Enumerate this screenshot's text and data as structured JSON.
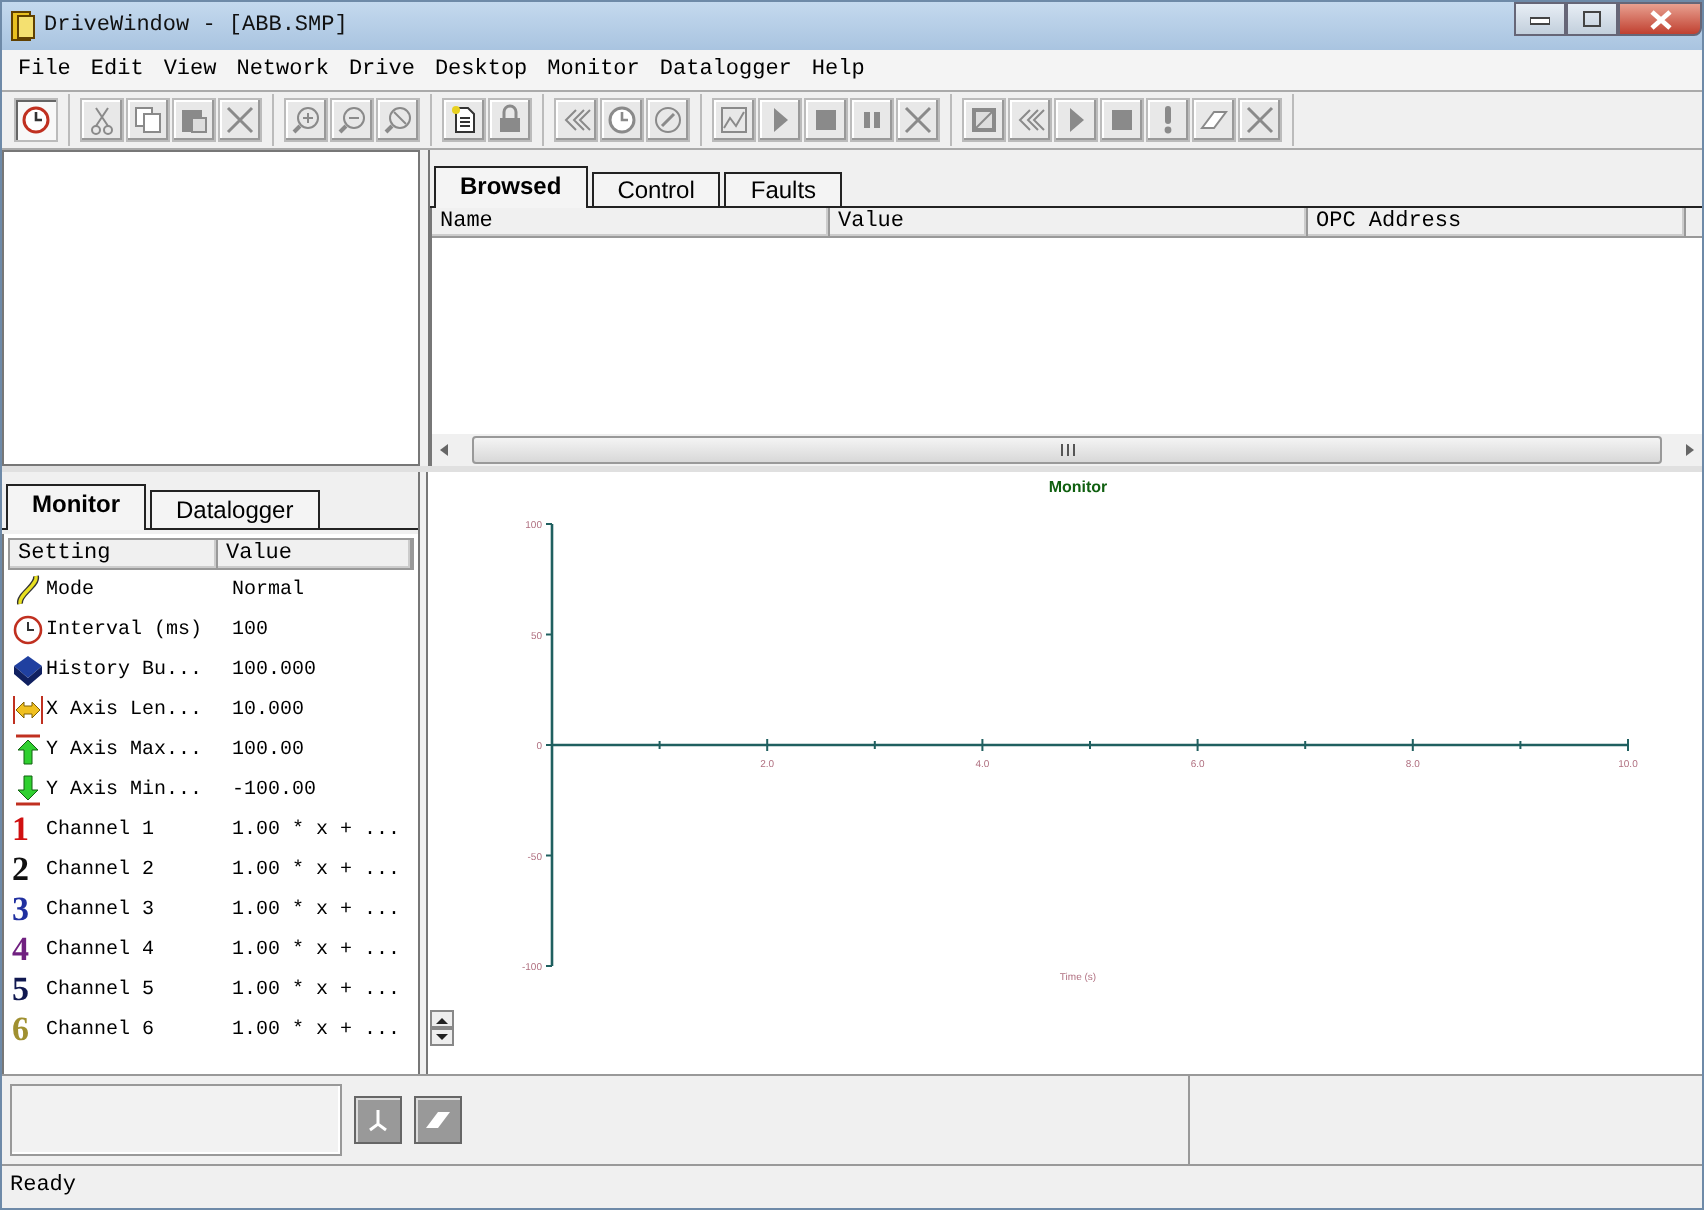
{
  "window": {
    "title": "DriveWindow - [ABB.SMP]"
  },
  "menu": [
    {
      "label": "File"
    },
    {
      "label": "Edit"
    },
    {
      "label": "View"
    },
    {
      "label": "Network"
    },
    {
      "label": "Drive"
    },
    {
      "label": "Desktop"
    },
    {
      "label": "Monitor"
    },
    {
      "label": "Datalogger"
    },
    {
      "label": "Help"
    }
  ],
  "toolbar": [
    [
      {
        "kind": "clock",
        "disabled": false,
        "pressed": true
      }
    ],
    [
      {
        "kind": "cut",
        "disabled": true,
        "pressed": false
      },
      {
        "kind": "copy",
        "disabled": true,
        "pressed": false
      },
      {
        "kind": "paste",
        "disabled": true,
        "pressed": false
      },
      {
        "kind": "delete",
        "disabled": true,
        "pressed": false
      }
    ],
    [
      {
        "kind": "zoom-in",
        "disabled": true,
        "pressed": false
      },
      {
        "kind": "zoom-out",
        "disabled": true,
        "pressed": false
      },
      {
        "kind": "zoom-reset",
        "disabled": true,
        "pressed": false
      }
    ],
    [
      {
        "kind": "new",
        "disabled": false,
        "pressed": false
      },
      {
        "kind": "lock",
        "disabled": true,
        "pressed": false
      }
    ],
    [
      {
        "kind": "rewind",
        "disabled": true,
        "pressed": false
      },
      {
        "kind": "clock",
        "disabled": true,
        "pressed": false
      },
      {
        "kind": "pen",
        "disabled": true,
        "pressed": false
      }
    ],
    [
      {
        "kind": "chart",
        "disabled": true,
        "pressed": false
      },
      {
        "kind": "play",
        "disabled": true,
        "pressed": false
      },
      {
        "kind": "stop",
        "disabled": true,
        "pressed": false
      },
      {
        "kind": "pause",
        "disabled": true,
        "pressed": false
      },
      {
        "kind": "delete",
        "disabled": true,
        "pressed": false
      }
    ],
    [
      {
        "kind": "frame",
        "disabled": true,
        "pressed": false
      },
      {
        "kind": "rewind",
        "disabled": true,
        "pressed": false
      },
      {
        "kind": "play",
        "disabled": true,
        "pressed": false
      },
      {
        "kind": "stop",
        "disabled": true,
        "pressed": false
      },
      {
        "kind": "exclaim",
        "disabled": true,
        "pressed": false
      },
      {
        "kind": "eraser",
        "disabled": true,
        "pressed": false
      },
      {
        "kind": "delete",
        "disabled": true,
        "pressed": false
      }
    ]
  ],
  "browser": {
    "tabs": [
      {
        "label": "Browsed",
        "selected": true
      },
      {
        "label": "Control",
        "selected": false
      },
      {
        "label": "Faults",
        "selected": false
      }
    ],
    "table": {
      "columns": [
        "Name",
        "Value",
        "OPC Address"
      ]
    }
  },
  "monitor_panel": {
    "tabs": [
      {
        "label": "Monitor",
        "selected": true
      },
      {
        "label": "Datalogger",
        "selected": false
      }
    ],
    "columns": [
      "Setting",
      "Value"
    ],
    "rows": [
      {
        "kind": "mode",
        "setting": "Mode",
        "value": "Normal"
      },
      {
        "kind": "clock",
        "setting": "Interval (ms)",
        "value": "100"
      },
      {
        "kind": "book",
        "setting": "History Bu...",
        "value": "100.000"
      },
      {
        "kind": "width",
        "setting": "X Axis Len...",
        "value": "10.000"
      },
      {
        "kind": "up",
        "setting": "Y Axis Max...",
        "value": "100.00"
      },
      {
        "kind": "down",
        "setting": "Y Axis Min...",
        "value": "-100.00"
      },
      {
        "kind": "channel",
        "badge": "1",
        "color": "#d01010",
        "setting": "Channel 1",
        "value": "1.00 * x + ..."
      },
      {
        "kind": "channel",
        "badge": "2",
        "color": "#101010",
        "setting": "Channel 2",
        "value": "1.00 * x + ..."
      },
      {
        "kind": "channel",
        "badge": "3",
        "color": "#2030a0",
        "setting": "Channel 3",
        "value": "1.00 * x + ..."
      },
      {
        "kind": "channel",
        "badge": "4",
        "color": "#702080",
        "setting": "Channel 4",
        "value": "1.00 * x + ..."
      },
      {
        "kind": "channel",
        "badge": "5",
        "color": "#101850",
        "setting": "Channel 5",
        "value": "1.00 * x + ..."
      },
      {
        "kind": "channel",
        "badge": "6",
        "color": "#a09030",
        "setting": "Channel 6",
        "value": "1.00 * x + ..."
      }
    ]
  },
  "chart": {
    "chart_data": {
      "type": "line",
      "title": "Monitor",
      "xlabel": "Time (s)",
      "xlim": [
        0,
        10
      ],
      "ylim": [
        -100,
        100
      ],
      "xticks": [
        {
          "value": 2,
          "label": "2.0"
        },
        {
          "value": 4,
          "label": "4.0"
        },
        {
          "value": 6,
          "label": "6.0"
        },
        {
          "value": 8,
          "label": "8.0"
        },
        {
          "value": 10,
          "label": "10.0"
        }
      ],
      "yticks": [
        {
          "value": 100,
          "label": "100"
        },
        {
          "value": 50,
          "label": "50"
        },
        {
          "value": 0,
          "label": "0"
        },
        {
          "value": -50,
          "label": "-50"
        },
        {
          "value": -100,
          "label": "-100"
        }
      ]
    }
  },
  "lower_toolbar": [
    {
      "kind": "scale"
    },
    {
      "kind": "eraser"
    }
  ],
  "status_bar": {
    "text": "Ready"
  }
}
